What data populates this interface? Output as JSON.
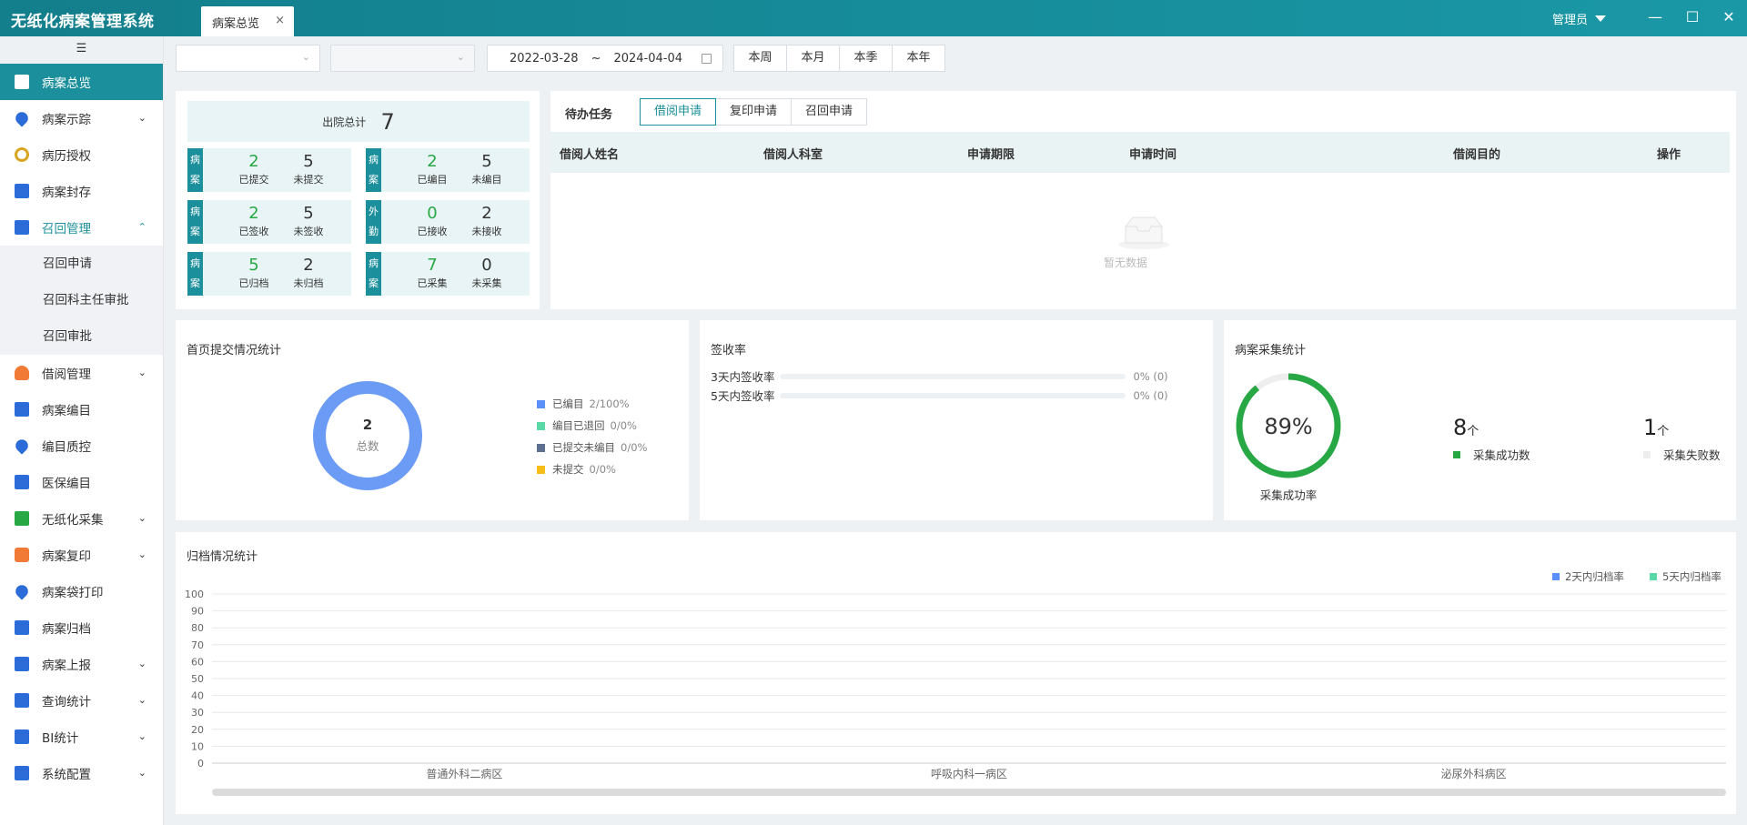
{
  "app": {
    "title": "无纸化病案管理系统"
  },
  "tab": {
    "label": "病案总览",
    "close": "×"
  },
  "user": {
    "name": "管理员"
  },
  "window": {
    "minimize": "—",
    "maximize": "☐",
    "close": "✕"
  },
  "sidebar": {
    "collapse_icon": "☰",
    "items": [
      {
        "label": "病案总览",
        "icon": "document-icon",
        "state": "active"
      },
      {
        "label": "病案示踪",
        "icon": "location-icon",
        "chevron": "⌄"
      },
      {
        "label": "病历授权",
        "icon": "authorize-icon"
      },
      {
        "label": "病案封存",
        "icon": "save-icon"
      },
      {
        "label": "召回管理",
        "icon": "list-icon",
        "chevron": "⌃",
        "state": "open"
      },
      {
        "label": "借阅管理",
        "icon": "hand-icon",
        "chevron": "⌄"
      },
      {
        "label": "病案编目",
        "icon": "list-icon"
      },
      {
        "label": "编目质控",
        "icon": "location-icon"
      },
      {
        "label": "医保编目",
        "icon": "list-icon"
      },
      {
        "label": "无纸化采集",
        "icon": "collect-icon",
        "chevron": "⌄"
      },
      {
        "label": "病案复印",
        "icon": "print-icon",
        "chevron": "⌄"
      },
      {
        "label": "病案袋打印",
        "icon": "location-icon"
      },
      {
        "label": "病案归档",
        "icon": "list-icon"
      },
      {
        "label": "病案上报",
        "icon": "list-icon",
        "chevron": "⌄"
      },
      {
        "label": "查询统计",
        "icon": "list-icon",
        "chevron": "⌄"
      },
      {
        "label": "BI统计",
        "icon": "list-icon",
        "chevron": "⌄"
      },
      {
        "label": "系统配置",
        "icon": "settings-icon",
        "chevron": "⌄"
      }
    ],
    "submenu": [
      "召回申请",
      "召回科主任审批",
      "召回审批"
    ]
  },
  "filters": {
    "date_start": "2022-03-28",
    "date_sep": "~",
    "date_end": "2024-04-04",
    "periods": [
      "本周",
      "本月",
      "本季",
      "本年"
    ]
  },
  "summary": {
    "label": "出院总计",
    "total": "7",
    "cards": [
      {
        "tag": "病案",
        "a_val": "2",
        "a_lbl": "已提交",
        "b_val": "5",
        "b_lbl": "未提交"
      },
      {
        "tag": "病案",
        "a_val": "2",
        "a_lbl": "已编目",
        "b_val": "5",
        "b_lbl": "未编目"
      },
      {
        "tag": "病案",
        "a_val": "2",
        "a_lbl": "已签收",
        "b_val": "5",
        "b_lbl": "未签收"
      },
      {
        "tag": "外勤",
        "a_val": "0",
        "a_lbl": "已接收",
        "b_val": "2",
        "b_lbl": "未接收"
      },
      {
        "tag": "病案",
        "a_val": "5",
        "a_lbl": "已归档",
        "b_val": "2",
        "b_lbl": "未归档"
      },
      {
        "tag": "病案",
        "a_val": "7",
        "a_lbl": "已采集",
        "b_val": "0",
        "b_lbl": "未采集"
      }
    ]
  },
  "todo": {
    "title": "待办任务",
    "tabs": [
      "借阅申请",
      "复印申请",
      "召回申请"
    ],
    "columns": [
      "借阅人姓名",
      "借阅人科室",
      "申请期限",
      "申请时间",
      "借阅目的",
      "操作"
    ],
    "empty": "暂无数据"
  },
  "home_submit": {
    "title": "首页提交情况统计",
    "total": "2",
    "total_label": "总数",
    "legend": [
      {
        "label": "已编目",
        "value": "2/100%",
        "color": "#5b8ff9"
      },
      {
        "label": "编目已退回",
        "value": "0/0%",
        "color": "#5ad8a6"
      },
      {
        "label": "已提交未编目",
        "value": "0/0%",
        "color": "#5d7092"
      },
      {
        "label": "未提交",
        "value": "0/0%",
        "color": "#f6bd16"
      }
    ]
  },
  "sign_rate": {
    "title": "签收率",
    "rows": [
      {
        "label": "3天内签收率",
        "value": "0% (0)",
        "fraction": 0
      },
      {
        "label": "5天内签收率",
        "value": "0% (0)",
        "fraction": 0
      }
    ]
  },
  "collect": {
    "title": "病案采集统计",
    "percent": "89%",
    "rate": 0.89,
    "rate_label": "采集成功率",
    "success_num": "8",
    "success_unit": "个",
    "success_label": "采集成功数",
    "fail_num": "1",
    "fail_unit": "个",
    "fail_label": "采集失败数",
    "colors": {
      "success": "#28a745",
      "fail": "#eeeeee"
    }
  },
  "chart_data": {
    "type": "bar",
    "title": "归档情况统计",
    "categories": [
      "普通外科二病区",
      "呼吸内科一病区",
      "泌尿外科病区"
    ],
    "series": [
      {
        "name": "2天内归档率",
        "values": [
          0,
          0,
          0
        ],
        "color": "#5b8ff9"
      },
      {
        "name": "5天内归档率",
        "values": [
          0,
          0,
          0
        ],
        "color": "#5ad8a6"
      }
    ],
    "ylim": [
      0,
      100
    ],
    "yticks": [
      "100",
      "90",
      "80",
      "70",
      "60",
      "50",
      "40",
      "30",
      "20",
      "10",
      "0"
    ],
    "grid": true,
    "legend": "top-right"
  }
}
